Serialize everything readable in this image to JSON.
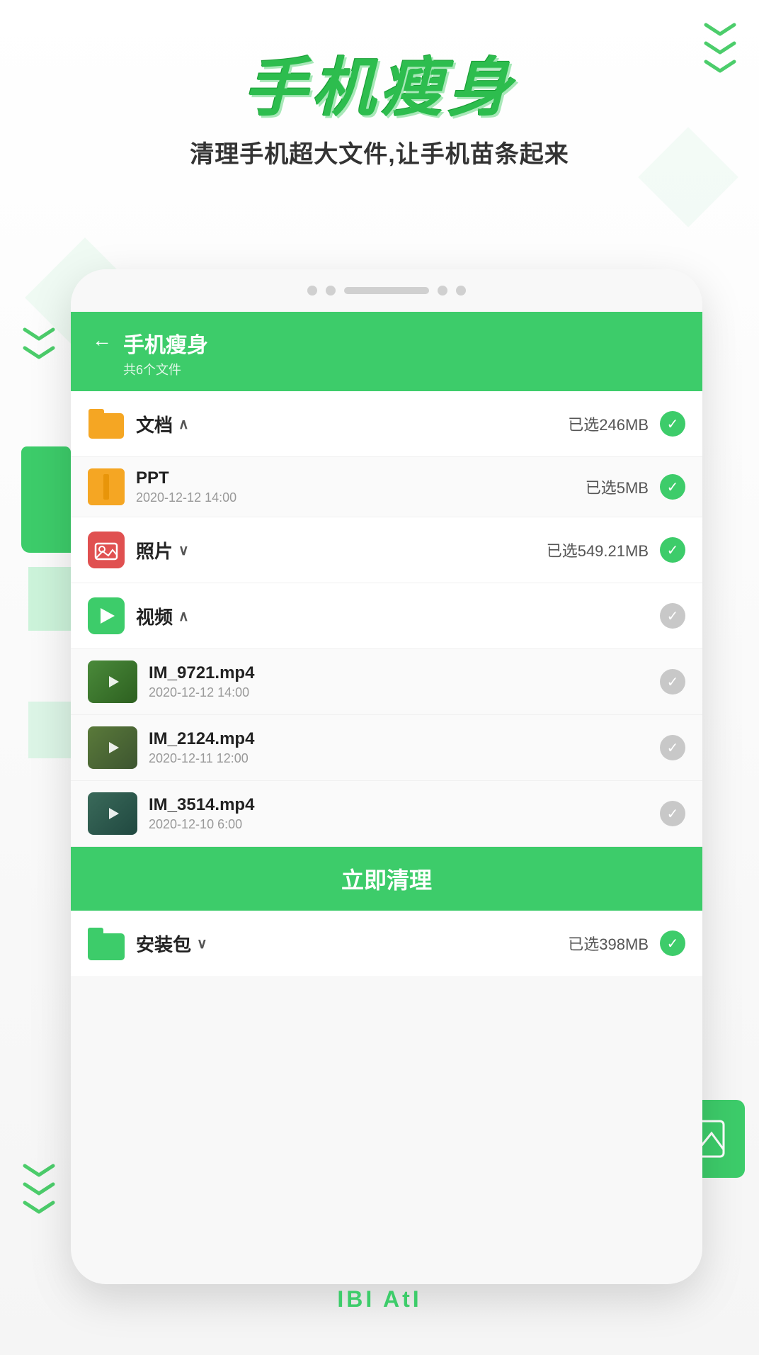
{
  "app": {
    "name": "手机瘦身",
    "hero_title": "手机瘦身",
    "hero_subtitle": "清理手机超大文件,让手机苗条起来",
    "bottom_text": "IBI AtI"
  },
  "phone": {
    "header": {
      "title": "手机瘦身",
      "subtitle": "共6个文件",
      "back_icon": "←"
    }
  },
  "categories": [
    {
      "id": "documents",
      "name": "文档",
      "icon_type": "folder",
      "expand": "up",
      "size": "已选246MB",
      "selected": true,
      "subitems": [
        {
          "name": "PPT",
          "date": "2020-12-12 14:00",
          "size": "已选5MB",
          "selected": true
        }
      ]
    },
    {
      "id": "photos",
      "name": "照片",
      "icon_type": "photo",
      "expand": "down",
      "size": "已选549.21MB",
      "selected": true,
      "subitems": []
    },
    {
      "id": "videos",
      "name": "视频",
      "icon_type": "video",
      "expand": "up",
      "size": "",
      "selected": false,
      "subitems": [
        {
          "name": "IM_9721.mp4",
          "date": "2020-12-12 14:00",
          "thumb": "1"
        },
        {
          "name": "IM_2124.mp4",
          "date": "2020-12-11 12:00",
          "thumb": "2"
        },
        {
          "name": "IM_3514.mp4",
          "date": "2020-12-10 6:00",
          "thumb": "3"
        }
      ]
    }
  ],
  "clean_button": {
    "label": "立即清理"
  },
  "install_package": {
    "name": "安装包",
    "expand": "down",
    "size": "已选398MB",
    "selected": true
  },
  "colors": {
    "green": "#3dcc6a",
    "dark_green": "#2dbd4e",
    "orange": "#f5a623",
    "red": "#e05050",
    "gray": "#c8c8c8"
  }
}
